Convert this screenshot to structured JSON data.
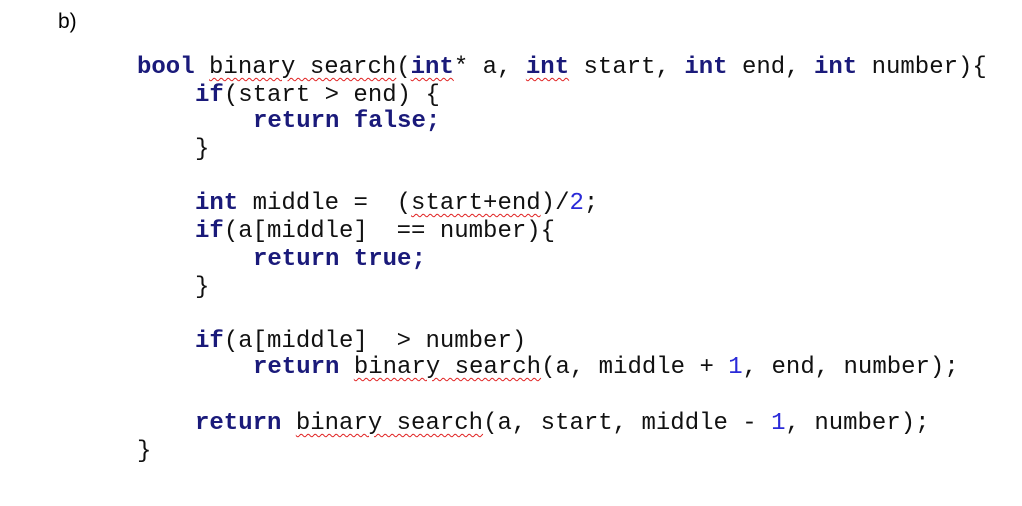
{
  "section_label": "b)",
  "code": {
    "language": "C++",
    "lines": [
      {
        "indent": 0,
        "tokens": [
          {
            "t": "bool",
            "k": "kw"
          },
          {
            "t": " "
          },
          {
            "t": "binary search",
            "k": "sq"
          },
          {
            "t": "("
          },
          {
            "t": "int",
            "k": "kw sq"
          },
          {
            "t": "* a, "
          },
          {
            "t": "int",
            "k": "kw sq"
          },
          {
            "t": " start, "
          },
          {
            "t": "int",
            "k": "kw"
          },
          {
            "t": " end, "
          },
          {
            "t": "int",
            "k": "kw"
          },
          {
            "t": " number){"
          }
        ]
      },
      {
        "indent": 1,
        "tokens": [
          {
            "t": "if",
            "k": "kw"
          },
          {
            "t": "(start > end) {"
          }
        ]
      },
      {
        "indent": 2,
        "tokens": [
          {
            "t": "return",
            "k": "kw"
          },
          {
            "t": " "
          },
          {
            "t": "false;",
            "k": "kw"
          }
        ]
      },
      {
        "indent": 1,
        "tokens": [
          {
            "t": "}"
          }
        ]
      },
      {
        "indent": 1,
        "tokens": [
          {
            "t": "int",
            "k": "kw"
          },
          {
            "t": " middle =  ("
          },
          {
            "t": "start+end",
            "k": "sq"
          },
          {
            "t": ")/"
          },
          {
            "t": "2",
            "k": "num"
          },
          {
            "t": ";"
          }
        ]
      },
      {
        "indent": 1,
        "tokens": [
          {
            "t": "if",
            "k": "kw"
          },
          {
            "t": "(a[middle]  == number){"
          }
        ]
      },
      {
        "indent": 2,
        "tokens": [
          {
            "t": "return",
            "k": "kw"
          },
          {
            "t": " "
          },
          {
            "t": "true;",
            "k": "kw"
          }
        ]
      },
      {
        "indent": 1,
        "tokens": [
          {
            "t": "}"
          }
        ]
      },
      {
        "indent": 1,
        "tokens": [
          {
            "t": "if",
            "k": "kw"
          },
          {
            "t": "(a[middle]  > number)"
          }
        ]
      },
      {
        "indent": 2,
        "tokens": [
          {
            "t": "return",
            "k": "kw"
          },
          {
            "t": " "
          },
          {
            "t": "binary search",
            "k": "sq"
          },
          {
            "t": "(a, middle + "
          },
          {
            "t": "1",
            "k": "num"
          },
          {
            "t": ", end, number);"
          }
        ]
      },
      {
        "indent": 1,
        "tokens": [
          {
            "t": "return",
            "k": "kw"
          },
          {
            "t": " "
          },
          {
            "t": "binary search",
            "k": "sq"
          },
          {
            "t": "(a, start, middle - "
          },
          {
            "t": "1",
            "k": "num"
          },
          {
            "t": ", number);"
          }
        ]
      },
      {
        "indent": 0,
        "tokens": [
          {
            "t": "}"
          }
        ]
      }
    ]
  },
  "colors": {
    "keyword": "#1a1a7a",
    "number": "#2a2ad8",
    "text": "#111111",
    "spellcheck_squiggle": "#e02020"
  }
}
